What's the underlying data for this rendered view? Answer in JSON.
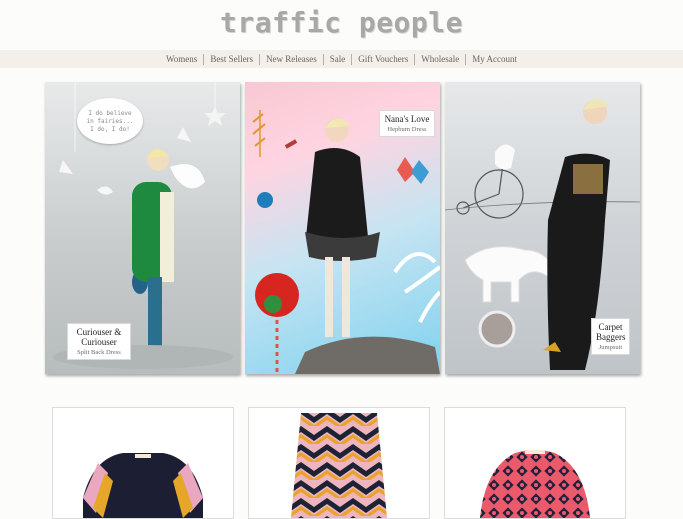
{
  "brand": {
    "logo_text": "traffic people"
  },
  "nav": {
    "items": [
      {
        "label": "Womens"
      },
      {
        "label": "Best Sellers"
      },
      {
        "label": "New Releases"
      },
      {
        "label": "Sale"
      },
      {
        "label": "Gift Vouchers"
      },
      {
        "label": "Wholesale"
      },
      {
        "label": "My Account"
      }
    ]
  },
  "banners": [
    {
      "title": "Curiouser & Curiouser",
      "subtitle": "Split Back Dress",
      "cloud_text": [
        "I do believe",
        "in fairies...",
        "I do, I do!"
      ]
    },
    {
      "title": "Nana's Love",
      "subtitle": "Hepburn Dress"
    },
    {
      "title": "Carpet Baggers",
      "subtitle": "Jumpsuit"
    }
  ],
  "colors": {
    "nav_bg": "#f3f0ec",
    "nav_text": "#6e6258",
    "logo": "#a8a8a6"
  }
}
